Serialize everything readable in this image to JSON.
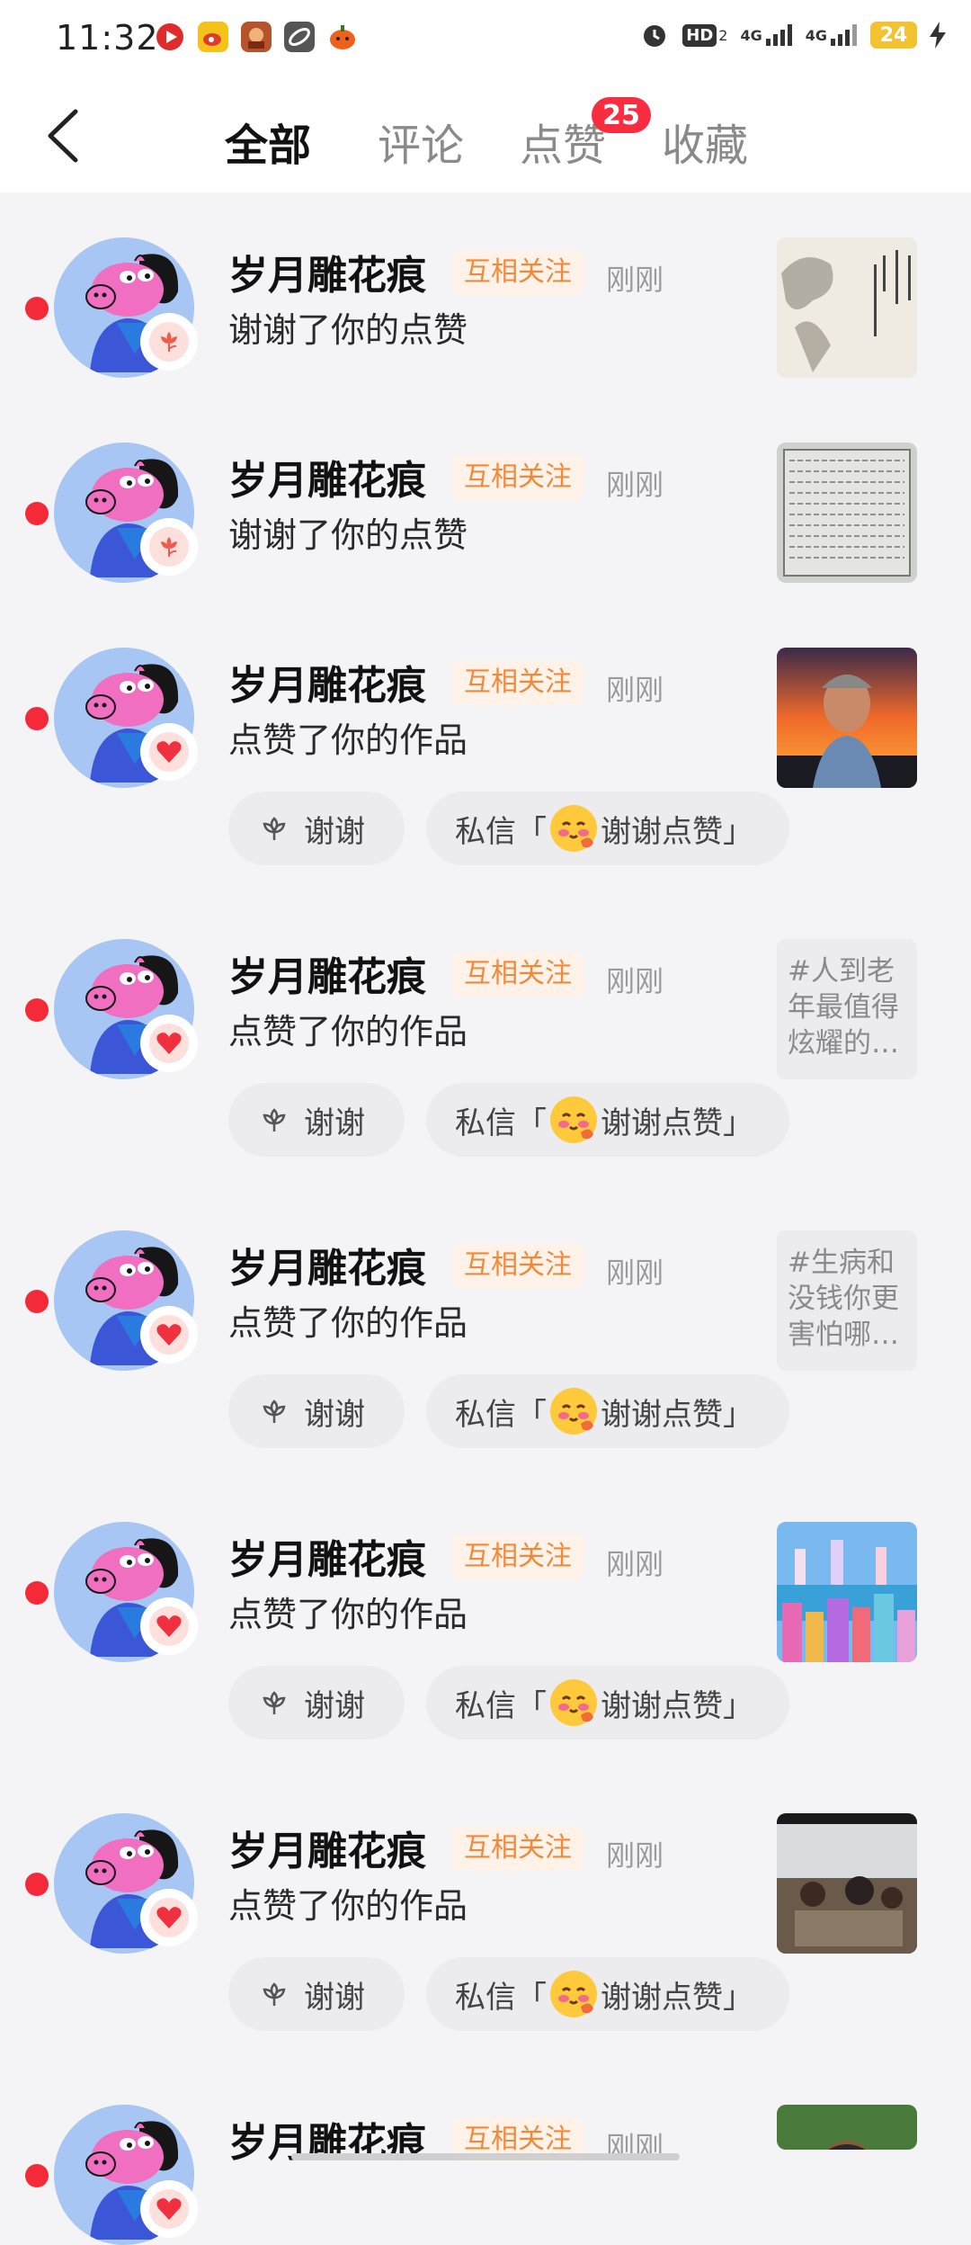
{
  "status_bar": {
    "time": "11:32",
    "network_hd": "HD",
    "network_sim": "2",
    "signal_1": "4G",
    "signal_2": "4G",
    "battery": "24"
  },
  "nav": {
    "back_icon": "chevron-left-icon",
    "tabs": [
      {
        "label": "全部",
        "active": true
      },
      {
        "label": "评论",
        "active": false
      },
      {
        "label": "点赞",
        "active": false
      },
      {
        "label": "收藏",
        "active": false
      }
    ],
    "likes_badge": "25"
  },
  "colors": {
    "unread_dot": "#f42a39",
    "tag_bg": "#fff2e9",
    "tag_text": "#f08a3a",
    "badge": "#fa2c3f"
  },
  "notifications": [
    {
      "user": "岁月雕花痕",
      "relation": "互相关注",
      "time": "刚刚",
      "action": "谢谢了你的点赞",
      "reaction": "flower-icon",
      "thumb": {
        "kind": "painting"
      },
      "has_actions": false
    },
    {
      "user": "岁月雕花痕",
      "relation": "互相关注",
      "time": "刚刚",
      "action": "谢谢了你的点赞",
      "reaction": "flower-icon",
      "thumb": {
        "kind": "handwriting"
      },
      "has_actions": false
    },
    {
      "user": "岁月雕花痕",
      "relation": "互相关注",
      "time": "刚刚",
      "action": "点赞了你的作品",
      "reaction": "heart-icon",
      "thumb": {
        "kind": "sunset-portrait"
      },
      "has_actions": true
    },
    {
      "user": "岁月雕花痕",
      "relation": "互相关注",
      "time": "刚刚",
      "action": "点赞了你的作品",
      "reaction": "heart-icon",
      "thumb": {
        "kind": "text",
        "text": "#人到老年最值得炫耀的…"
      },
      "has_actions": true
    },
    {
      "user": "岁月雕花痕",
      "relation": "互相关注",
      "time": "刚刚",
      "action": "点赞了你的作品",
      "reaction": "heart-icon",
      "thumb": {
        "kind": "text",
        "text": "#生病和没钱你更害怕哪…"
      },
      "has_actions": true
    },
    {
      "user": "岁月雕花痕",
      "relation": "互相关注",
      "time": "刚刚",
      "action": "点赞了你的作品",
      "reaction": "heart-icon",
      "thumb": {
        "kind": "city"
      },
      "has_actions": true
    },
    {
      "user": "岁月雕花痕",
      "relation": "互相关注",
      "time": "刚刚",
      "action": "点赞了你的作品",
      "reaction": "heart-icon",
      "thumb": {
        "kind": "classroom"
      },
      "has_actions": true
    },
    {
      "user": "岁月雕花痕",
      "relation": "互相关注",
      "time": "刚刚",
      "action": "",
      "reaction": "heart-icon",
      "thumb": {
        "kind": "man-outdoor"
      },
      "has_actions": false
    }
  ],
  "reply_actions": {
    "thanks_label": "谢谢",
    "dm_prefix": "私信「",
    "dm_text": "谢谢点赞」",
    "dm_emoji": "blush-emoji-icon"
  }
}
